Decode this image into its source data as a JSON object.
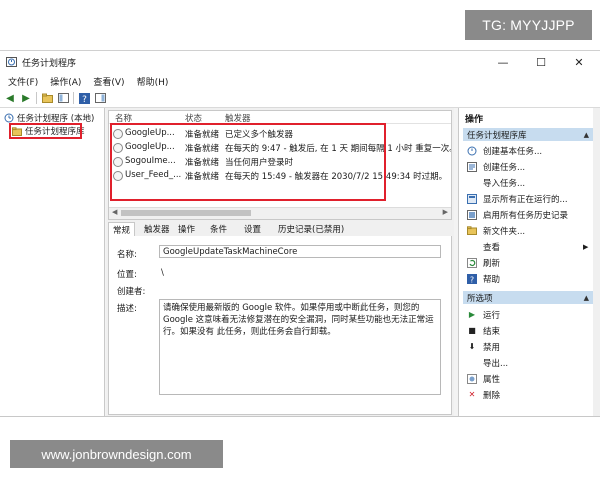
{
  "watermark_top": "TG: MYYJJPP",
  "watermark_bottom": "www.jonbrowndesign.com",
  "window": {
    "title": "任务计划程序",
    "minimize": "—",
    "maximize": "☐",
    "close": "✕"
  },
  "menu": [
    "文件(F)",
    "操作(A)",
    "查看(V)",
    "帮助(H)"
  ],
  "tree": {
    "root": "任务计划程序 (本地)",
    "child": "任务计划程序库"
  },
  "list": {
    "headers": [
      "名称",
      "状态",
      "触发器"
    ],
    "rows": [
      {
        "name": "GoogleUp...",
        "status": "准备就绪",
        "trigger": "已定义多个触发器"
      },
      {
        "name": "GoogleUp...",
        "status": "准备就绪",
        "trigger": "在每天的 9:47 - 触发后, 在 1 天 期间每隔 1 小时 重复一次。"
      },
      {
        "name": "SogouIme...",
        "status": "准备就绪",
        "trigger": "当任何用户登录时"
      },
      {
        "name": "User_Feed_...",
        "status": "准备就绪",
        "trigger": "在每天的 15:49 - 触发器在 2030/7/2 15:49:34 时过期。"
      }
    ]
  },
  "tabs": [
    "常规",
    "触发器",
    "操作",
    "条件",
    "设置",
    "历史记录(已禁用)"
  ],
  "detail": {
    "name_label": "名称:",
    "name_value": "GoogleUpdateTaskMachineCore",
    "location_label": "位置:",
    "location_value": "\\",
    "author_label": "创建者:",
    "desc_label": "描述:",
    "desc_value": "请确保使用最新版的 Google 软件。如果停用或中断此任务，则您的 Google 这意味着无法修复潜在的安全漏洞，同时某些功能也无法正常运行。如果没有 此任务，则此任务会自行卸载。"
  },
  "actions": {
    "title": "操作",
    "section1": "任务计划程序库",
    "items1": [
      {
        "icon": "create-basic-task-icon",
        "label": "创建基本任务..."
      },
      {
        "icon": "create-task-icon",
        "label": "创建任务..."
      },
      {
        "icon": "import-task-icon",
        "label": "导入任务..."
      },
      {
        "icon": "show-running-icon",
        "label": "显示所有正在运行的..."
      },
      {
        "icon": "history-icon",
        "label": "启用所有任务历史记录"
      },
      {
        "icon": "folder-icon",
        "label": "新文件夹..."
      },
      {
        "icon": "view-icon",
        "label": "查看"
      },
      {
        "icon": "refresh-icon",
        "label": "刷新"
      },
      {
        "icon": "help-icon",
        "label": "帮助"
      }
    ],
    "section2": "所选项",
    "items2": [
      {
        "icon": "run-icon",
        "label": "运行"
      },
      {
        "icon": "end-icon",
        "label": "结束"
      },
      {
        "icon": "disable-icon",
        "label": "禁用"
      },
      {
        "icon": "export-icon",
        "label": "导出..."
      },
      {
        "icon": "properties-icon",
        "label": "属性"
      },
      {
        "icon": "delete-icon",
        "label": "删除"
      }
    ]
  },
  "colors": {
    "highlight_box": "#e0202c",
    "action_header": "#c7dcef"
  }
}
